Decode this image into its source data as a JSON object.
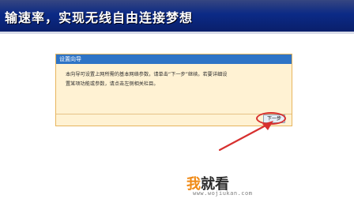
{
  "banner": {
    "title": "输速率，实现无线自由连接梦想"
  },
  "dialog": {
    "title": "设置向导",
    "body_line1": "本向导可设置上网所需的基本网络参数，请单击“下一步”继续。若要详细设",
    "body_line2": "置某项功能或参数，请点击左侧相关栏目。",
    "next_button": "下一步"
  },
  "watermark": {
    "logo_first": "我",
    "logo_rest": "就看",
    "url": "www.wojiukan.com"
  },
  "colors": {
    "banner": "#0b2a86",
    "dialog_bg": "#fff2d3",
    "dialog_title": "#2e74c6",
    "annotation": "#d7302f",
    "watermark_accent": "#f08a16"
  }
}
